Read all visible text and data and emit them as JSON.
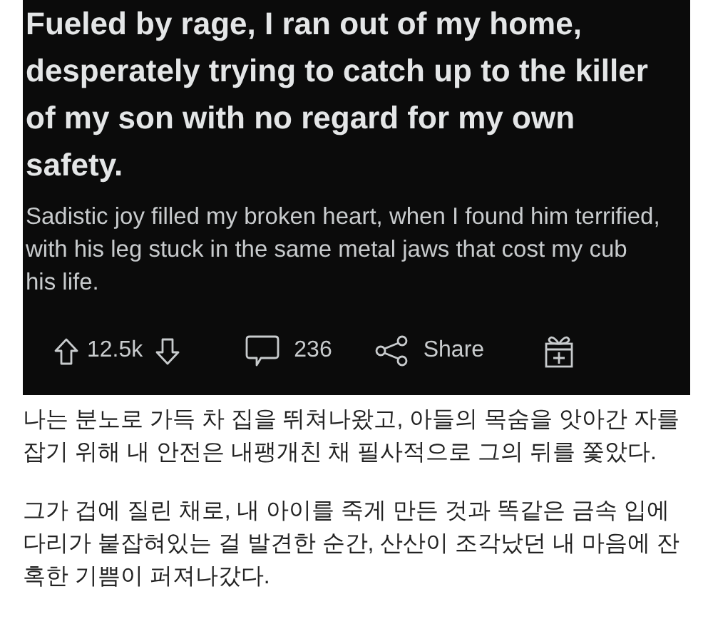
{
  "post": {
    "title": "Fueled by rage, I ran out of my home, desperately trying to catch up to the killer of my son with no regard for my own safety.",
    "body": "Sadistic joy filled my broken heart, when I found him terrified, with his leg stuck in the same metal jaws that cost my cub his life."
  },
  "actions": {
    "votes": "12.5k",
    "comments": "236",
    "share": "Share"
  },
  "translation": [
    "나는 분노로 가득 차 집을 뛰쳐나왔고, 아들의 목숨을 앗아간 자를 잡기 위해 내 안전은 내팽개친 채 필사적으로 그의 뒤를 쫓았다.",
    "그가 겁에 질린 채로, 내 아이를 죽게 만든 것과 똑같은 금속 입에 다리가 붙잡혀있는 걸 발견한 순간, 산산이 조각났던 내 마음에 잔혹한 기쁨이 퍼져나갔다."
  ]
}
